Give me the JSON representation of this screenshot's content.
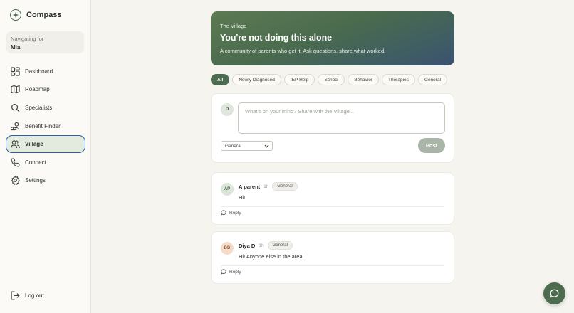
{
  "brand": {
    "name": "Compass"
  },
  "navigating_for": {
    "label": "Navigating for",
    "value": "Mia"
  },
  "nav": [
    {
      "label": "Dashboard",
      "icon": "dashboard-icon"
    },
    {
      "label": "Roadmap",
      "icon": "map-icon"
    },
    {
      "label": "Specialists",
      "icon": "search-icon"
    },
    {
      "label": "Benefit Finder",
      "icon": "benefit-icon"
    },
    {
      "label": "Village",
      "icon": "users-icon",
      "active": true
    },
    {
      "label": "Connect",
      "icon": "phone-icon"
    },
    {
      "label": "Settings",
      "icon": "gear-icon"
    }
  ],
  "logout": {
    "label": "Log out",
    "icon": "logout-icon"
  },
  "hero": {
    "eyebrow": "The Village",
    "title": "You're not doing this alone",
    "subtitle": "A community of parents who get it. Ask questions, share what worked."
  },
  "filters": [
    "All",
    "Newly Diagnosed",
    "IEP Help",
    "School",
    "Behavior",
    "Therapies",
    "General"
  ],
  "active_filter": "All",
  "composer": {
    "avatar": "D",
    "placeholder": "What's on your mind? Share with the Village...",
    "category": "General",
    "post_label": "Post"
  },
  "posts": [
    {
      "initials": "AP",
      "author": "A parent",
      "time": "1h",
      "tag": "General",
      "body": "Hi!",
      "reply_label": "Reply"
    },
    {
      "initials": "DD",
      "author": "Diya D",
      "time": "1h",
      "tag": "General",
      "body": "Hi! Anyone else in the area!",
      "reply_label": "Reply"
    }
  ],
  "colors": {
    "accent": "#4d6b4f",
    "active_border": "#2f5fa8",
    "background": "#f6f4ef"
  }
}
